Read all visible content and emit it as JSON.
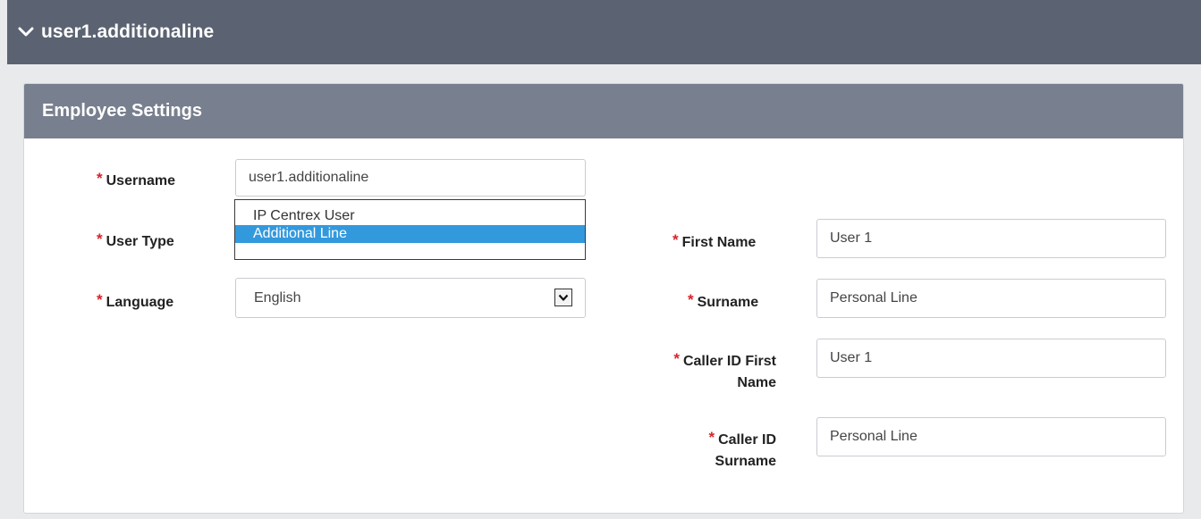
{
  "header": {
    "title": "user1.additionaline",
    "icon": "chevron-down-icon"
  },
  "panel": {
    "title": "Employee Settings"
  },
  "colors": {
    "header_bg": "#5b6372",
    "panel_header_bg": "#787f8e",
    "required": "#d8232a",
    "selected_option": "#3399dd"
  },
  "form": {
    "required_mark": "*",
    "username": {
      "label": "Username",
      "value": "user1.additionaline"
    },
    "user_type": {
      "label": "User Type",
      "options": [
        "IP Centrex User",
        "Additional Line"
      ],
      "selected": "Additional Line"
    },
    "language": {
      "label": "Language",
      "value": "English"
    },
    "first_name": {
      "label": "First Name",
      "value": "User 1"
    },
    "surname": {
      "label": "Surname",
      "value": "Personal Line"
    },
    "caller_id_first_name": {
      "label_line1": "Caller ID First",
      "label_line2": "Name",
      "value": "User 1"
    },
    "caller_id_surname": {
      "label_line1": "Caller ID",
      "label_line2": "Surname",
      "value": "Personal Line"
    }
  }
}
